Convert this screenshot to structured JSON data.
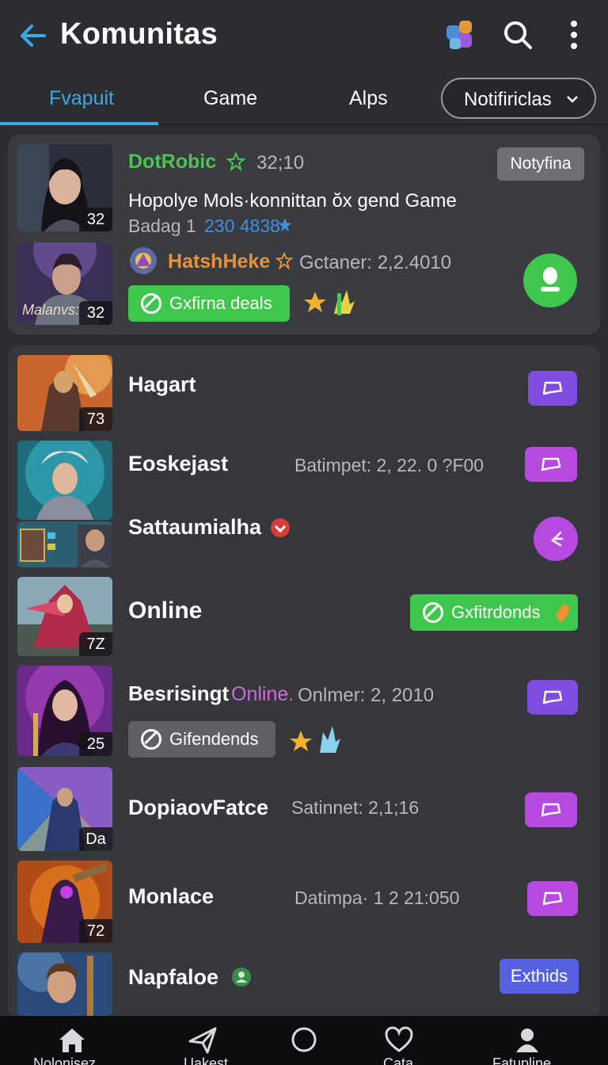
{
  "appbar": {
    "title": "Komunitas"
  },
  "tabs": {
    "items": [
      "Fvapuit",
      "Game",
      "Alps"
    ],
    "notification_label": "Notifiriclas"
  },
  "featured": {
    "user": "DotRobic",
    "time": "32;10",
    "notify_button": "Notyfina",
    "headline": "Hopolye Mols·konnittan ŏx gend Game",
    "sub_label": "Badag 1",
    "sub_value": "230 4838",
    "thumb1_badge": "32",
    "thumb2_badge": "32",
    "thumb2_overlay": "Malanvs:",
    "second_user": "HatshHeke",
    "second_meta": "Gctaner: 2,2.4010",
    "chip_label": "Gxfirna deals"
  },
  "list": [
    {
      "name": "Hagart",
      "meta": "",
      "badge": "73"
    },
    {
      "name": "Eoskejast",
      "meta": "Batimpet: 2, 22. 0 ?F00",
      "badge": ""
    },
    {
      "name": "Sattaumialha",
      "meta": "",
      "badge": ""
    },
    {
      "name": "Online",
      "meta": "",
      "badge": "7Z",
      "chip": "Gxfitrdonds"
    },
    {
      "name": "Besrisingt",
      "highlight": "Online.",
      "meta": "Onlmer:  2, 2010",
      "badge": "25",
      "chip": "Gifendends"
    },
    {
      "name": "DopiaovFatce",
      "meta": "Satinnet: 2,1;16",
      "badge": "Da"
    },
    {
      "name": "Monlace",
      "meta": "Datimpa· 1  2 21:050",
      "badge": "72"
    },
    {
      "name": "Napfaloe",
      "meta": "",
      "badge": "",
      "button": "Exthids"
    }
  ],
  "bottom_nav": [
    "Nolonisez",
    "Uakest",
    "Cata",
    "",
    "Fatupline"
  ],
  "colors": {
    "accent": "#3ba9e6",
    "green": "#3fc64d",
    "purple": "#7e4de0",
    "magenta": "#b649e0"
  }
}
